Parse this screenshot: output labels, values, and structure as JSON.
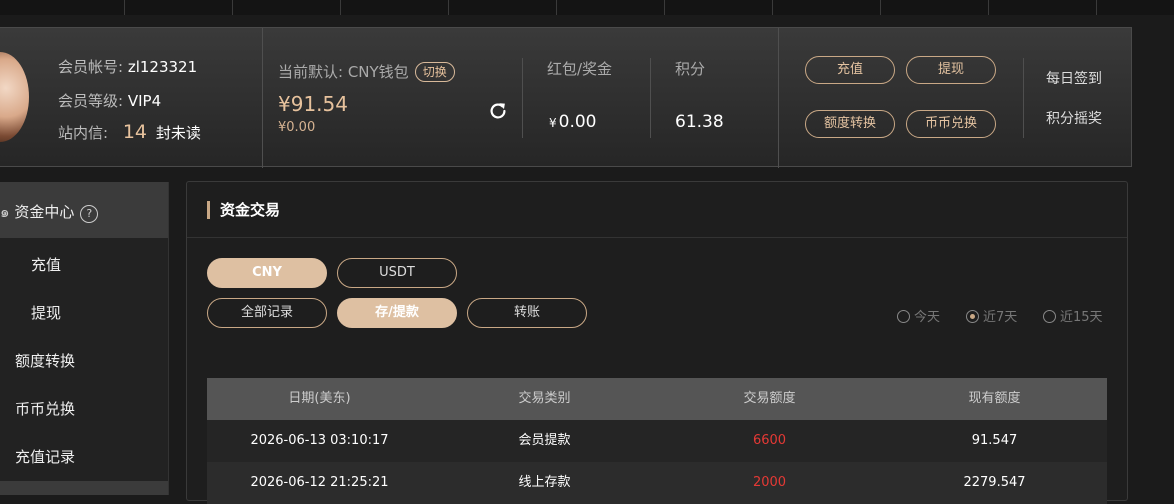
{
  "member": {
    "account_label": "会员帐号:",
    "account_value": "zl123321",
    "level_label": "会员等级:",
    "level_value": "VIP4",
    "inbox_label": "站内信:",
    "inbox_count": "14",
    "inbox_suffix": "封未读"
  },
  "wallet": {
    "default_label": "当前默认: CNY钱包",
    "switch_label": "切换",
    "balance": "¥91.54",
    "balance_sub": "¥0.00",
    "refresh_icon": "refresh-icon"
  },
  "bonus": {
    "title": "红包/奖金",
    "currency": "¥",
    "value": "0.00"
  },
  "points": {
    "title": "积分",
    "value": "61.38"
  },
  "actions": {
    "recharge": "充值",
    "withdraw": "提现",
    "transfer": "额度转换",
    "exchange": "币币兑换"
  },
  "side_links": {
    "checkin": "每日签到",
    "lottery": "积分摇奖"
  },
  "sidebar": {
    "header": "资金中心",
    "help": "?",
    "items": [
      "充值",
      "提现",
      "额度转换",
      "币币兑换",
      "充值记录"
    ]
  },
  "panel": {
    "title": "资金交易",
    "currency_tabs": [
      "CNY",
      "USDT"
    ],
    "record_tabs": [
      "全部记录",
      "存/提款",
      "转账"
    ],
    "ranges": [
      "今天",
      "近7天",
      "近15天"
    ],
    "selected_range": "近7天"
  },
  "table": {
    "headers": [
      "日期(美东)",
      "交易类别",
      "交易额度",
      "现有额度"
    ],
    "rows": [
      [
        "2026-06-13 03:10:17",
        "会员提款",
        "6600",
        "91.547"
      ],
      [
        "2026-06-12 21:25:21",
        "线上存款",
        "2000",
        "2279.547"
      ]
    ]
  },
  "colors": {
    "accent": "#c9a886",
    "negative": "#e53935",
    "tab_active_bg": "#dec0a2"
  }
}
